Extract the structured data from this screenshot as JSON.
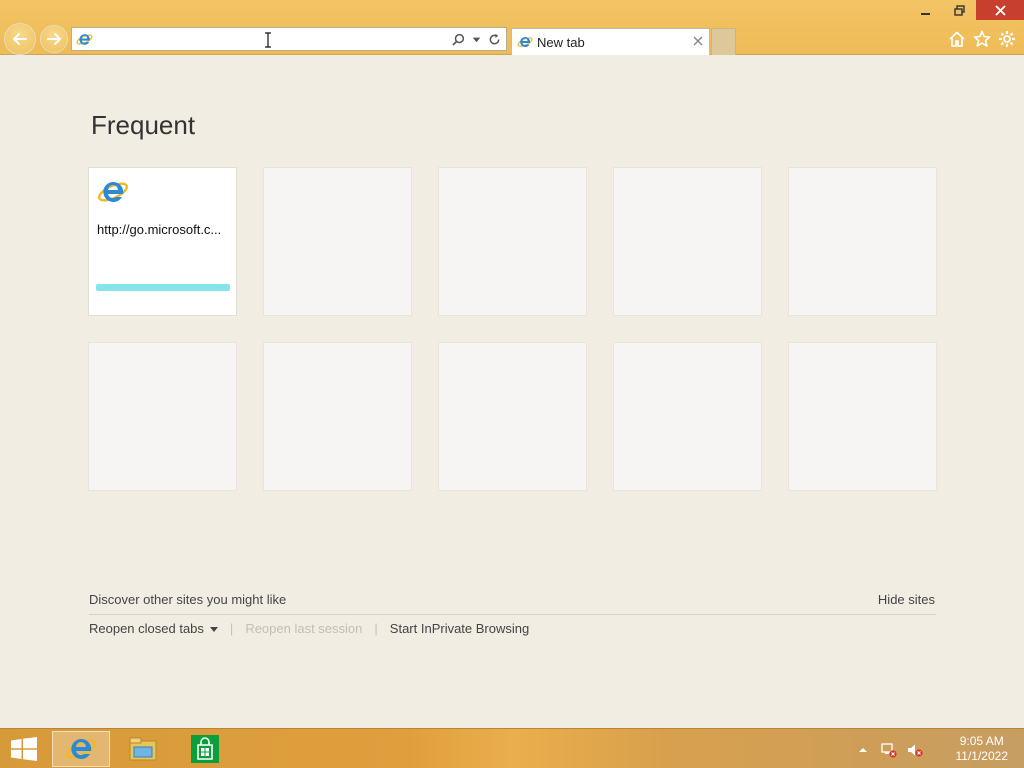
{
  "browser": {
    "address": {
      "value": "",
      "placeholder": ""
    },
    "tab": {
      "label": "New tab"
    }
  },
  "page": {
    "heading": "Frequent",
    "tiles": [
      {
        "url": "http://go.microsoft.c...",
        "bar_fill": 1.0
      }
    ],
    "discover_label": "Discover other sites you might like",
    "hide_sites_label": "Hide sites",
    "reopen_closed_tabs": "Reopen closed tabs",
    "reopen_last_session": "Reopen last session",
    "start_inprivate": "Start InPrivate Browsing"
  },
  "taskbar": {
    "time": "9:05 AM",
    "date": "11/1/2022"
  },
  "colors": {
    "chrome": "#f0bf5c",
    "page_bg": "#f1ede3",
    "tile_bar": "#86e4ec",
    "close_btn": "#c7402e"
  },
  "icons": [
    "back-icon",
    "forward-icon",
    "ie-icon",
    "search-icon",
    "dropdown-icon",
    "refresh-icon",
    "close-tab-icon",
    "minimize-icon",
    "restore-icon",
    "close-icon",
    "home-icon",
    "favorites-icon",
    "tools-icon",
    "windows-start-icon",
    "file-explorer-icon",
    "store-icon",
    "tray-up-icon",
    "network-icon",
    "volume-muted-icon"
  ]
}
